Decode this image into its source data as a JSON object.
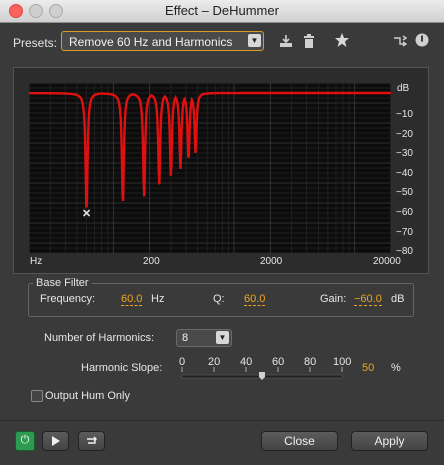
{
  "window": {
    "title": "Effect – DeHummer"
  },
  "presets": {
    "label": "Presets:",
    "selected": "Remove 60 Hz and Harmonics"
  },
  "graph": {
    "unit_label": "dB",
    "db_ticks": [
      "−10",
      "−20",
      "−30",
      "−40",
      "−50",
      "−60",
      "−70",
      "−80"
    ],
    "freq_ticks": [
      "Hz",
      "200",
      "2000",
      "20000"
    ],
    "curve_color": "#e01010",
    "notches_db": [
      {
        "freq": 60,
        "depth": -60
      },
      {
        "freq": 120,
        "depth": -56
      },
      {
        "freq": 180,
        "depth": -52
      },
      {
        "freq": 240,
        "depth": -46
      },
      {
        "freq": 300,
        "depth": -42
      },
      {
        "freq": 360,
        "depth": -38
      },
      {
        "freq": 420,
        "depth": -34
      },
      {
        "freq": 480,
        "depth": -30
      }
    ]
  },
  "base_filter": {
    "title": "Base Filter",
    "frequency_label": "Frequency:",
    "frequency_value": "60.0",
    "frequency_unit": "Hz",
    "q_label": "Q:",
    "q_value": "60.0",
    "gain_label": "Gain:",
    "gain_value": "−60.0",
    "gain_unit": "dB"
  },
  "harmonics": {
    "label": "Number of Harmonics:",
    "value": "8"
  },
  "slope": {
    "label": "Harmonic Slope:",
    "ticks": [
      "0",
      "20",
      "40",
      "60",
      "80",
      "100"
    ],
    "value": "50",
    "unit": "%",
    "level_percent": 50
  },
  "output_hum": {
    "label": "Output Hum Only",
    "checked": false
  },
  "buttons": {
    "close": "Close",
    "apply": "Apply"
  },
  "colors": {
    "accent": "#f0a61c",
    "power": "#2e9b52"
  }
}
